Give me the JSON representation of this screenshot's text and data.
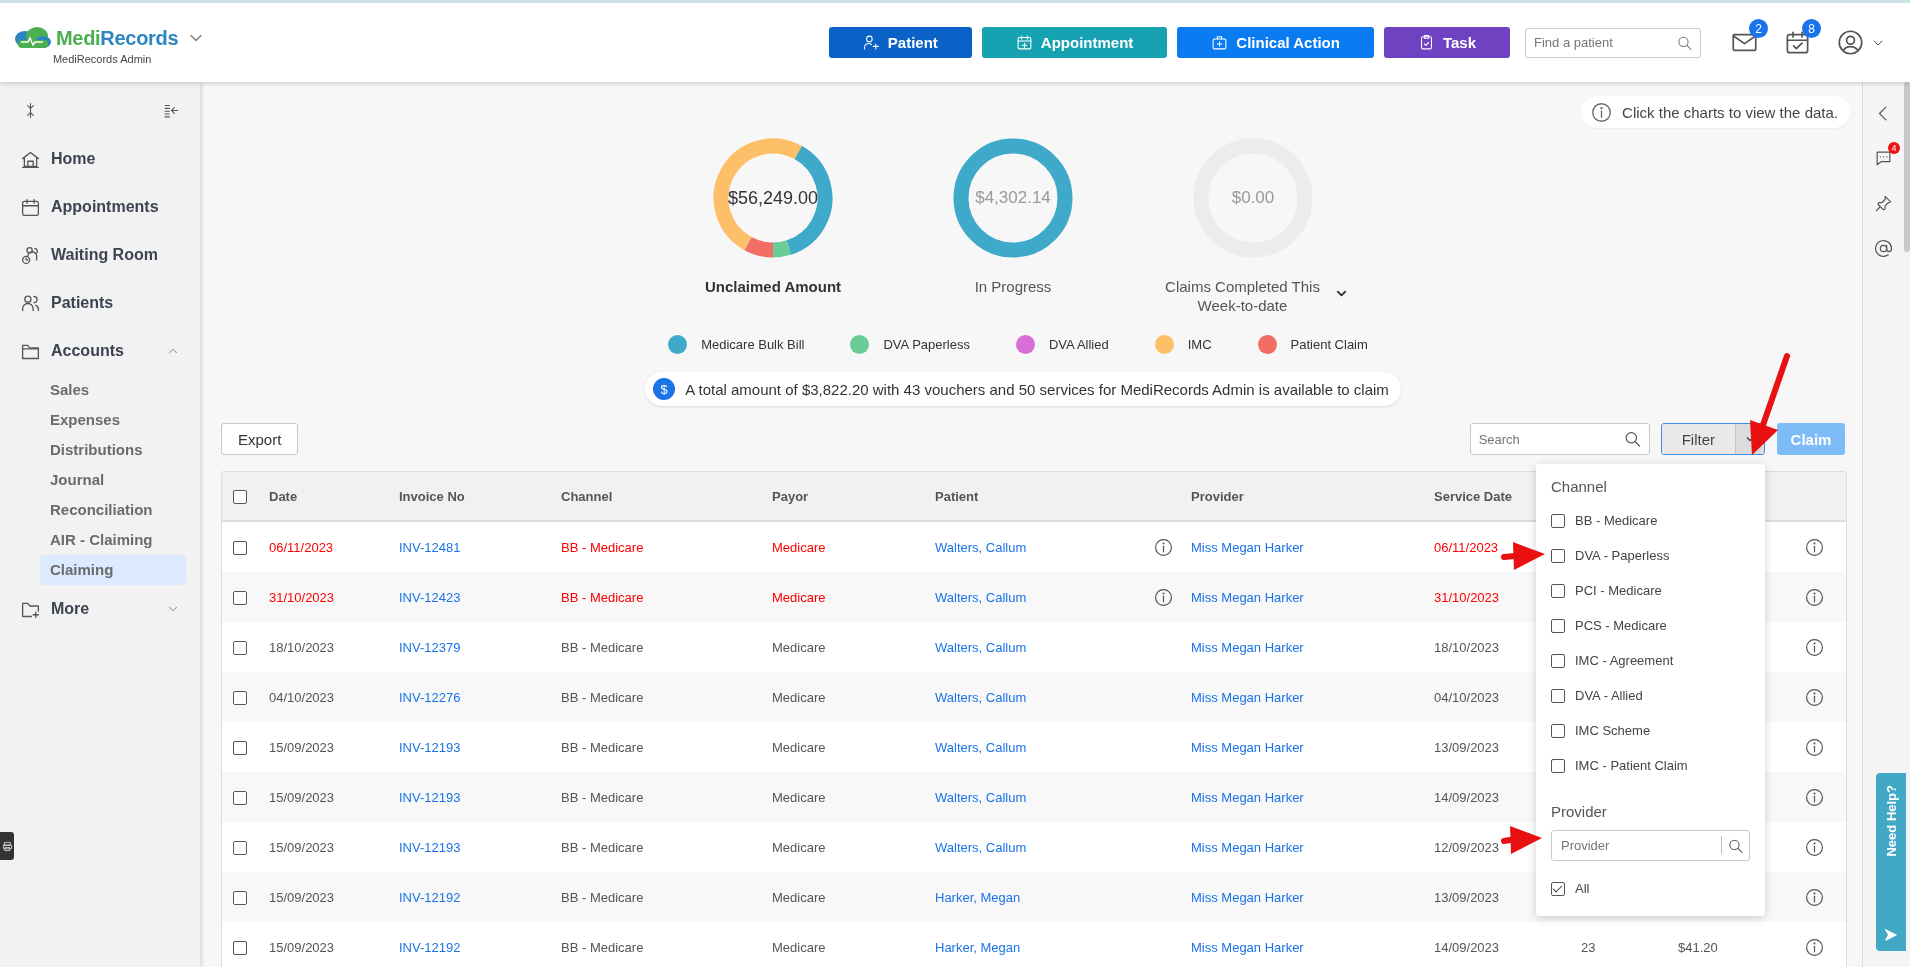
{
  "header": {
    "brand_lead": "Medi",
    "brand_rest": "Records",
    "org": "MediRecords Admin",
    "actions": [
      {
        "label": "Patient",
        "color": "#0a62c9"
      },
      {
        "label": "Appointment",
        "color": "#17a2b2"
      },
      {
        "label": "Clinical Action",
        "color": "#0b7bf1"
      },
      {
        "label": "Task",
        "color": "#6f42c1"
      }
    ],
    "search": {
      "placeholder": "Find a patient"
    },
    "messages": {
      "count": "2"
    },
    "tasks": {
      "count": "8"
    }
  },
  "sidebar": {
    "items": [
      {
        "label": "Home",
        "kind": "link",
        "selected": false
      },
      {
        "label": "Appointments",
        "kind": "link",
        "selected": false
      },
      {
        "label": "Waiting Room",
        "kind": "link",
        "selected": false
      },
      {
        "label": "Patients",
        "kind": "link",
        "selected": false
      },
      {
        "label": "Accounts",
        "kind": "group",
        "expanded": true,
        "children": [
          {
            "label": "Sales",
            "selected": false
          },
          {
            "label": "Expenses",
            "selected": false
          },
          {
            "label": "Distributions",
            "selected": false
          },
          {
            "label": "Journal",
            "selected": false
          },
          {
            "label": "Reconciliation",
            "selected": false
          },
          {
            "label": "AIR - Claiming",
            "selected": false
          },
          {
            "label": "Claiming",
            "selected": true
          }
        ]
      },
      {
        "label": "More",
        "kind": "group",
        "expanded": false
      }
    ]
  },
  "hint": "Click the charts to view the data.",
  "charts": [
    {
      "label": "Unclaimed Amount",
      "amount": "$56,249.00",
      "kind": "mixed",
      "selected": true,
      "dropdown": false
    },
    {
      "label": "In Progress",
      "amount": "$4,302.14",
      "kind": "progress",
      "selected": false,
      "dropdown": false
    },
    {
      "label": "Claims Completed This Week-to-date",
      "amount": "$0.00",
      "kind": "empty",
      "selected": false,
      "dropdown": true
    }
  ],
  "legend": [
    {
      "label": "Medicare Bulk Bill",
      "color": "#3fa9c9"
    },
    {
      "label": "DVA Paperless",
      "color": "#6acc97"
    },
    {
      "label": "DVA Allied",
      "color": "#d86fd6"
    },
    {
      "label": "IMC",
      "color": "#fdbf68"
    },
    {
      "label": "Patient Claim",
      "color": "#f26d63"
    }
  ],
  "banner": {
    "icon": "$",
    "text": "A total amount of $3,822.20 with 43 vouchers and 50 services for MediRecords Admin is available to claim"
  },
  "toolbar": {
    "export": "Export",
    "search_placeholder": "Search",
    "filter": "Filter",
    "claim": {
      "label": "Claim",
      "disabled": true
    }
  },
  "filter_menu": {
    "open": true,
    "channel_heading": "Channel",
    "channels": [
      {
        "label": "BB - Medicare",
        "checked": false
      },
      {
        "label": "DVA - Paperless",
        "checked": false
      },
      {
        "label": "PCI - Medicare",
        "checked": false
      },
      {
        "label": "PCS - Medicare",
        "checked": false
      },
      {
        "label": "IMC - Agreement",
        "checked": false
      },
      {
        "label": "DVA - Allied",
        "checked": false
      },
      {
        "label": "IMC Scheme",
        "checked": false
      },
      {
        "label": "IMC - Patient Claim",
        "checked": false
      }
    ],
    "provider_heading": "Provider",
    "provider_placeholder": "Provider",
    "all": {
      "label": "All",
      "checked": true
    }
  },
  "right_rail": {
    "chat_count": "4",
    "help": "Need Help?"
  },
  "table": {
    "select_all": false,
    "columns": [
      "Date",
      "Invoice No",
      "Channel",
      "Payor",
      "Patient",
      "Provider",
      "Service Date"
    ],
    "rows": [
      {
        "checked": false,
        "flagged": true,
        "date": "06/11/2023",
        "invoice": "INV-12481",
        "channel": "BB - Medicare",
        "payor": "Medicare",
        "patient": "Walters, Callum",
        "note": true,
        "provider": "Miss Megan Harker",
        "service_date": "06/11/2023"
      },
      {
        "checked": false,
        "flagged": true,
        "date": "31/10/2023",
        "invoice": "INV-12423",
        "channel": "BB - Medicare",
        "payor": "Medicare",
        "patient": "Walters, Callum",
        "note": true,
        "provider": "Miss Megan Harker",
        "service_date": "31/10/2023"
      },
      {
        "checked": false,
        "flagged": false,
        "date": "18/10/2023",
        "invoice": "INV-12379",
        "channel": "BB - Medicare",
        "payor": "Medicare",
        "patient": "Walters, Callum",
        "note": false,
        "provider": "Miss Megan Harker",
        "service_date": "18/10/2023"
      },
      {
        "checked": false,
        "flagged": false,
        "date": "04/10/2023",
        "invoice": "INV-12276",
        "channel": "BB - Medicare",
        "payor": "Medicare",
        "patient": "Walters, Callum",
        "note": false,
        "provider": "Miss Megan Harker",
        "service_date": "04/10/2023"
      },
      {
        "checked": false,
        "flagged": false,
        "date": "15/09/2023",
        "invoice": "INV-12193",
        "channel": "BB - Medicare",
        "payor": "Medicare",
        "patient": "Walters, Callum",
        "note": false,
        "provider": "Miss Megan Harker",
        "service_date": "13/09/2023"
      },
      {
        "checked": false,
        "flagged": false,
        "date": "15/09/2023",
        "invoice": "INV-12193",
        "channel": "BB - Medicare",
        "payor": "Medicare",
        "patient": "Walters, Callum",
        "note": false,
        "provider": "Miss Megan Harker",
        "service_date": "14/09/2023"
      },
      {
        "checked": false,
        "flagged": false,
        "date": "15/09/2023",
        "invoice": "INV-12193",
        "channel": "BB - Medicare",
        "payor": "Medicare",
        "patient": "Walters, Callum",
        "note": false,
        "provider": "Miss Megan Harker",
        "service_date": "12/09/2023"
      },
      {
        "checked": false,
        "flagged": false,
        "date": "15/09/2023",
        "invoice": "INV-12192",
        "channel": "BB - Medicare",
        "payor": "Medicare",
        "patient": "Harker, Megan",
        "note": false,
        "provider": "Miss Megan Harker",
        "service_date": "13/09/2023"
      },
      {
        "checked": false,
        "flagged": false,
        "date": "15/09/2023",
        "invoice": "INV-12192",
        "channel": "BB - Medicare",
        "payor": "Medicare",
        "patient": "Harker, Megan",
        "note": false,
        "provider": "Miss Megan Harker",
        "service_date": "14/09/2023",
        "column_9": "23",
        "column_10": "$41.20"
      }
    ]
  }
}
